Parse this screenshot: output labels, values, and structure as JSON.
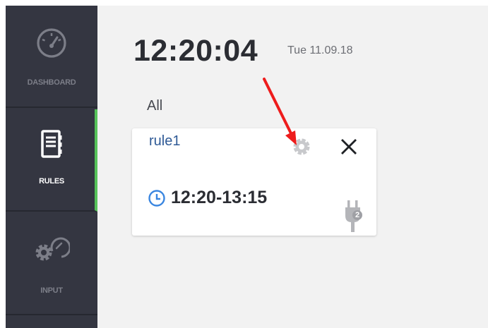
{
  "sidebar": {
    "items": [
      {
        "label": "DASHBOARD",
        "icon": "speedometer-icon",
        "active": false
      },
      {
        "label": "RULES",
        "icon": "notebook-icon",
        "active": true
      },
      {
        "label": "INPUT",
        "icon": "gear-gauge-icon",
        "active": false
      }
    ]
  },
  "header": {
    "time": "12:20:04",
    "date": "Tue 11.09.18"
  },
  "filter": {
    "label": "All"
  },
  "rule_card": {
    "name": "rule1",
    "time_range": "12:20-13:15",
    "plug_count": "2",
    "icons": [
      "settings-icon",
      "close-icon",
      "clock-icon",
      "plug-icon"
    ]
  },
  "annotation": {
    "color": "#ee1c1c",
    "icon": "red-arrow"
  },
  "colors": {
    "sidebar_bg": "#343641",
    "active_accent": "#56c25a",
    "main_bg": "#f2f2f2",
    "rule_name": "#2f5a96",
    "clock_icon": "#3a86e0"
  }
}
